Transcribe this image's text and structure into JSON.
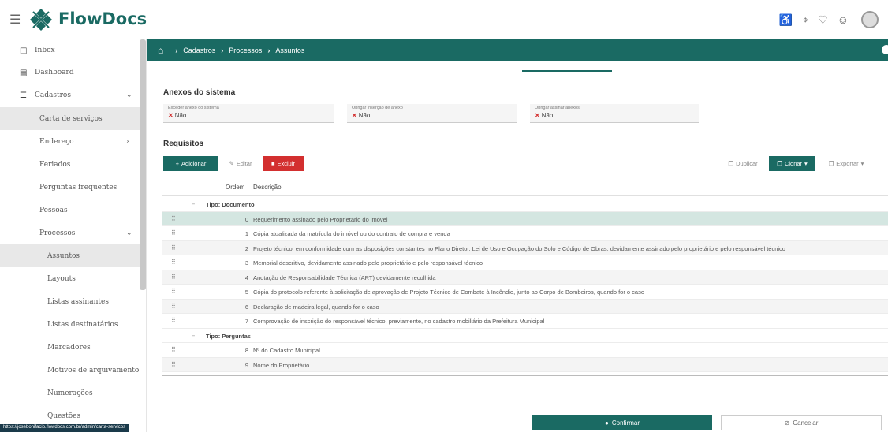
{
  "app": {
    "name": "FlowDocs"
  },
  "sidebar": {
    "top_items": [
      {
        "label": "Inbox",
        "icon": "inbox-icon"
      },
      {
        "label": "Dashboard",
        "icon": "chart-icon"
      },
      {
        "label": "Cadastros",
        "icon": "list-icon"
      }
    ],
    "items": [
      {
        "label": "Carta de serviços"
      },
      {
        "label": "Endereço"
      },
      {
        "label": "Feriados"
      },
      {
        "label": "Perguntas frequentes"
      },
      {
        "label": "Pessoas"
      },
      {
        "label": "Processos"
      }
    ],
    "subitems": [
      {
        "label": "Assuntos"
      },
      {
        "label": "Layouts"
      },
      {
        "label": "Listas assinantes"
      },
      {
        "label": "Listas destinatários"
      },
      {
        "label": "Marcadores"
      },
      {
        "label": "Motivos de arquivamento"
      },
      {
        "label": "Numerações"
      },
      {
        "label": "Questões"
      }
    ]
  },
  "breadcrumb": [
    "Cadastros",
    "Processos",
    "Assuntos"
  ],
  "anexos": {
    "title": "Anexos do sistema",
    "fields": [
      {
        "label": "Exceder anexo do sistema",
        "value": "Não"
      },
      {
        "label": "Obrigar inserção de anexo",
        "value": "Não"
      },
      {
        "label": "Obrigar assinar anexos",
        "value": "Não"
      }
    ]
  },
  "requisitos": {
    "title": "Requisitos",
    "buttons": {
      "add": "Adicionar",
      "edit": "Editar",
      "delete": "Excluir",
      "duplicate": "Duplicar",
      "clone": "Clonar",
      "export": "Exportar"
    },
    "columns": {
      "order": "Ordem",
      "description": "Descrição"
    },
    "groups": [
      {
        "label": "Tipo: Documento",
        "rows": [
          {
            "order": "0",
            "desc": "Requerimento assinado pelo Proprietário do imóvel"
          },
          {
            "order": "1",
            "desc": "Cópia atualizada da matrícula do imóvel ou do contrato de compra e venda"
          },
          {
            "order": "2",
            "desc": "Projeto técnico, em conformidade com as disposições constantes no Plano Diretor, Lei de Uso e Ocupação do Solo e Código de Obras, devidamente assinado pelo proprietário e pelo responsável técnico"
          },
          {
            "order": "3",
            "desc": "Memorial descritivo, devidamente assinado pelo proprietário e pelo responsável técnico"
          },
          {
            "order": "4",
            "desc": "Anotação de Responsabilidade Técnica (ART) devidamente recolhida"
          },
          {
            "order": "5",
            "desc": "Cópia do protocolo referente à solicitação de aprovação de Projeto Técnico de Combate à Incêndio, junto ao Corpo de Bombeiros, quando for o caso"
          },
          {
            "order": "6",
            "desc": "Declaração de madeira legal, quando for o caso"
          },
          {
            "order": "7",
            "desc": "Comprovação de inscrição do responsável técnico, previamente, no cadastro mobiliário da Prefeitura Municipal"
          }
        ]
      },
      {
        "label": "Tipo: Perguntas",
        "rows": [
          {
            "order": "8",
            "desc": "Nº do Cadastro Municipal"
          },
          {
            "order": "9",
            "desc": "Nome do Proprietário"
          }
        ]
      }
    ]
  },
  "footer": {
    "confirm": "Confirmar",
    "cancel": "Cancelar"
  },
  "status_url": "https://josebonifacio.flowdocs.com.br/admin/carta-servicos",
  "colors": {
    "primary": "#1a6a63",
    "danger": "#d32f2f",
    "selected_row": "#d4e6e1"
  }
}
